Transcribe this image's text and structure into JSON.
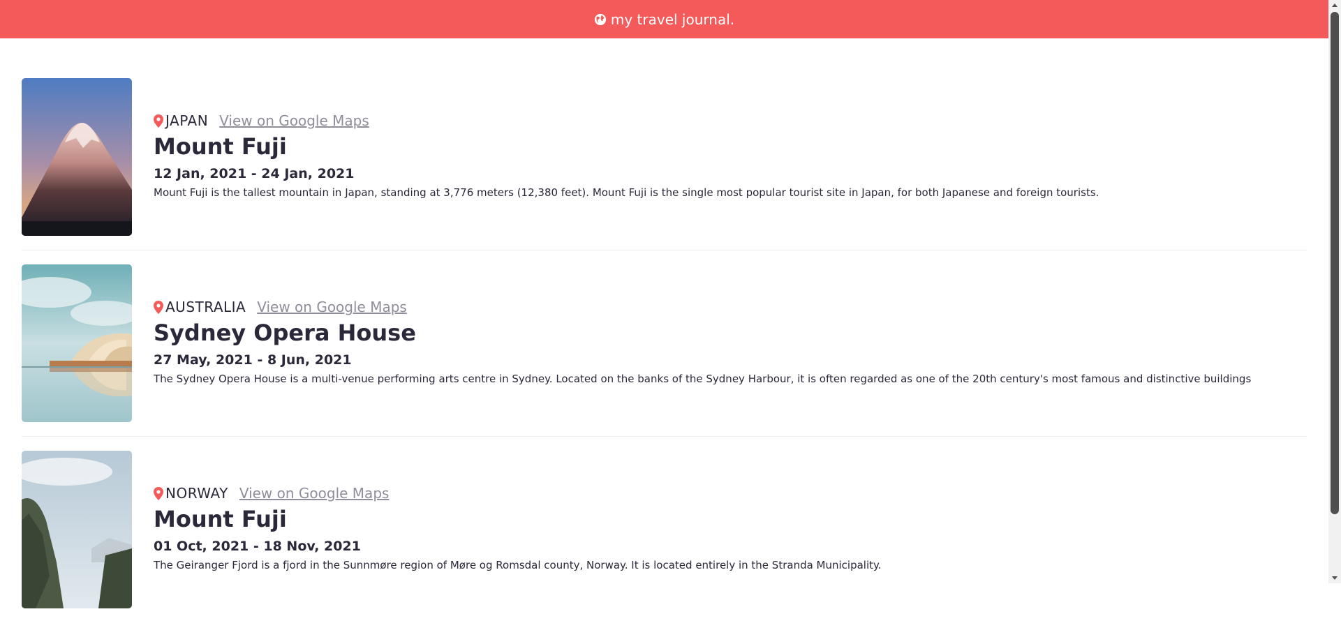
{
  "header": {
    "title": "my travel journal.",
    "icon": "globe-icon"
  },
  "entries": [
    {
      "country": "JAPAN",
      "map_link": "View on Google Maps",
      "title": "Mount Fuji",
      "dates": "12 Jan, 2021 - 24 Jan, 2021",
      "description": "Mount Fuji is the tallest mountain in Japan, standing at 3,776 meters (12,380 feet). Mount Fuji is the single most popular tourist site in Japan, for both Japanese and foreign tourists."
    },
    {
      "country": "AUSTRALIA",
      "map_link": "View on Google Maps",
      "title": "Sydney Opera House",
      "dates": "27 May, 2021 - 8 Jun, 2021",
      "description": "The Sydney Opera House is a multi-venue performing arts centre in Sydney. Located on the banks of the Sydney Harbour, it is often regarded as one of the 20th century's most famous and distinctive buildings"
    },
    {
      "country": "NORWAY",
      "map_link": "View on Google Maps",
      "title": "Mount Fuji",
      "dates": "01 Oct, 2021 - 18 Nov, 2021",
      "description": "The Geiranger Fjord is a fjord in the Sunnmøre region of Møre og Romsdal county, Norway. It is located entirely in the Stranda Municipality."
    }
  ],
  "colors": {
    "brand": "#f55a5a",
    "pin": "#f55a5a",
    "link": "#918e9b",
    "text": "#2b283a"
  }
}
